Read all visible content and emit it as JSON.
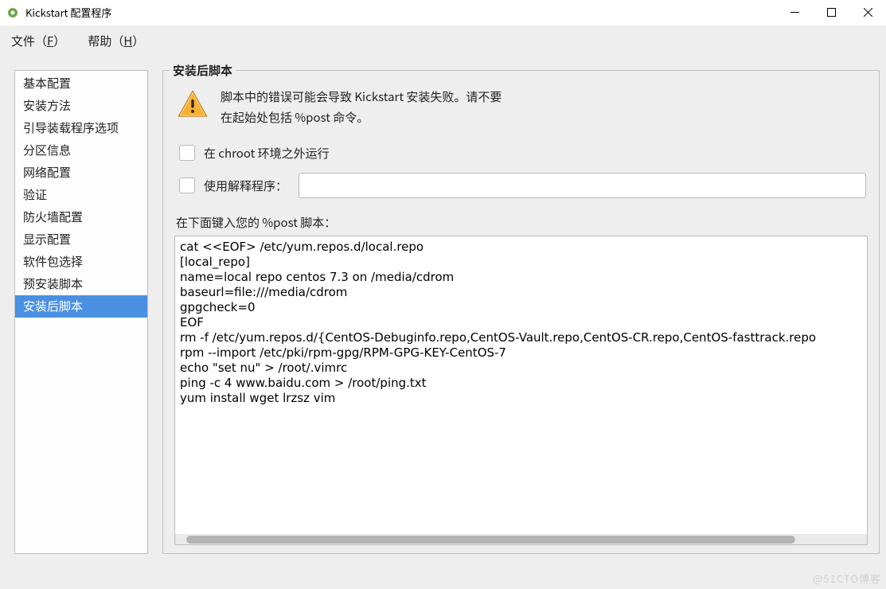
{
  "window": {
    "title": "Kickstart 配置程序"
  },
  "menu": {
    "file": "文件（F）",
    "file_u": "F",
    "help": "帮助（H）",
    "help_u": "H"
  },
  "sidebar": {
    "items": [
      {
        "label": "基本配置"
      },
      {
        "label": "安装方法"
      },
      {
        "label": "引导装载程序选项"
      },
      {
        "label": "分区信息"
      },
      {
        "label": "网络配置"
      },
      {
        "label": "验证"
      },
      {
        "label": "防火墙配置"
      },
      {
        "label": "显示配置"
      },
      {
        "label": "软件包选择"
      },
      {
        "label": "预安装脚本"
      },
      {
        "label": "安装后脚本"
      }
    ],
    "active_index": 10
  },
  "panel": {
    "legend": "安装后脚本",
    "warning_line1": "脚本中的错误可能会导致   Kickstart  安装失败。请不要",
    "warning_line2": "在起始处包括 %post 命令。",
    "chroot_label": "在  chroot 环境之外运行",
    "interp_label": "使用解释程序：",
    "interp_value": "",
    "prompt": "在下面键入您的 %post 脚本：",
    "script": "cat <<EOF> /etc/yum.repos.d/local.repo\n[local_repo]\nname=local repo centos 7.3 on /media/cdrom\nbaseurl=file:///media/cdrom\ngpgcheck=0\nEOF\nrm -f /etc/yum.repos.d/{CentOS-Debuginfo.repo,CentOS-Vault.repo,CentOS-CR.repo,CentOS-fasttrack.repo\nrpm --import /etc/pki/rpm-gpg/RPM-GPG-KEY-CentOS-7\necho \"set nu\" > /root/.vimrc\nping -c 4 www.baidu.com > /root/ping.txt\nyum install wget lrzsz vim"
  },
  "watermark": "@51CTO博客"
}
